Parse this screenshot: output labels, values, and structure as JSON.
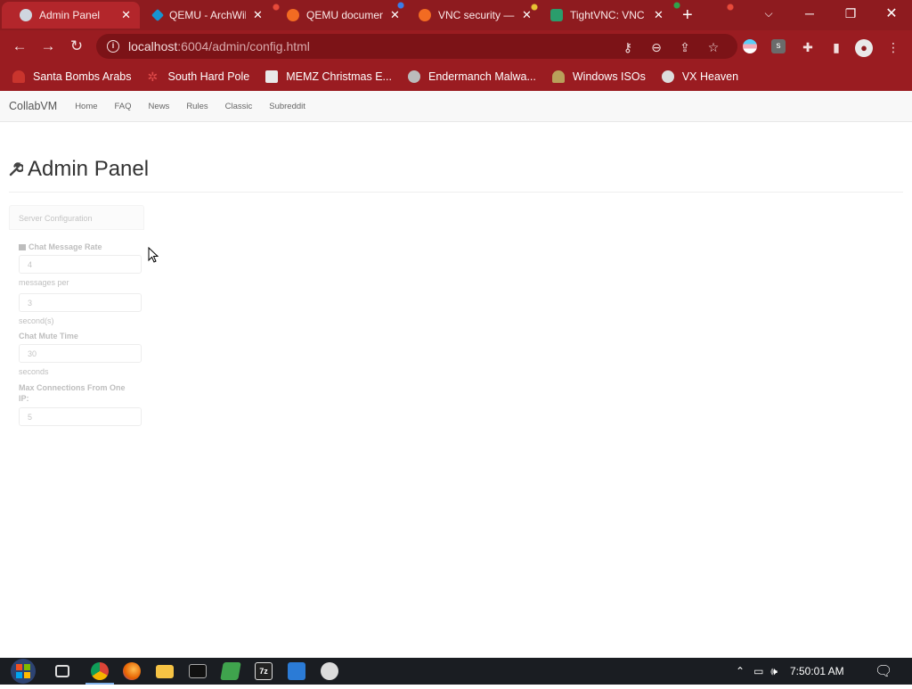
{
  "tabs": [
    {
      "title": "Admin Panel",
      "active": true,
      "favicon_color": "#cfd6df",
      "icon": "globe-icon"
    },
    {
      "title": "QEMU - ArchWiki",
      "active": false,
      "favicon_color": "#1793d1",
      "icon": "archwiki-icon"
    },
    {
      "title": "QEMU documentation",
      "active": false,
      "favicon_color": "#f26b22",
      "icon": "qemu-icon"
    },
    {
      "title": "VNC security — TigerVNC",
      "active": false,
      "favicon_color": "#f26b22",
      "icon": "tigervnc-icon"
    },
    {
      "title": "TightVNC: VNC",
      "active": false,
      "favicon_color": "#2a9d6c",
      "icon": "tightvnc-icon"
    }
  ],
  "toolbar": {
    "url_host": "localhost",
    "url_rest": ":6004/admin/config.html"
  },
  "bookmarks": [
    {
      "label": "Santa Bombs Arabs",
      "icon": "santa-icon",
      "color": "#c9342d"
    },
    {
      "label": "South Hard Pole",
      "icon": "snowflake-icon",
      "color": "#e04a4a"
    },
    {
      "label": "MEMZ Christmas E...",
      "icon": "memz-icon",
      "color": "#e9e9e9"
    },
    {
      "label": "Endermanch Malwa...",
      "icon": "endermanch-icon",
      "color": "#bbbbbb"
    },
    {
      "label": "Windows ISOs",
      "icon": "windows-isos-icon",
      "color": "#b9a05a"
    },
    {
      "label": "VX Heaven",
      "icon": "vx-heaven-icon",
      "color": "#dddddd"
    }
  ],
  "site": {
    "brand": "CollabVM",
    "nav": [
      "Home",
      "FAQ",
      "News",
      "Rules",
      "Classic",
      "Subreddit"
    ]
  },
  "page": {
    "title": "Admin Panel",
    "panel_heading": "Server Configuration",
    "chat_rate_label": "Chat Message Rate",
    "chat_rate_messages": "4",
    "messages_per": "messages per",
    "chat_rate_seconds": "3",
    "seconds_unit": "second(s)",
    "mute_label": "Chat Mute Time",
    "mute_value": "30",
    "mute_unit": "seconds",
    "max_conn_label": "Max Connections From One IP:",
    "max_conn_value": "5"
  },
  "taskbar": {
    "clock": "7:50:01 AM"
  }
}
